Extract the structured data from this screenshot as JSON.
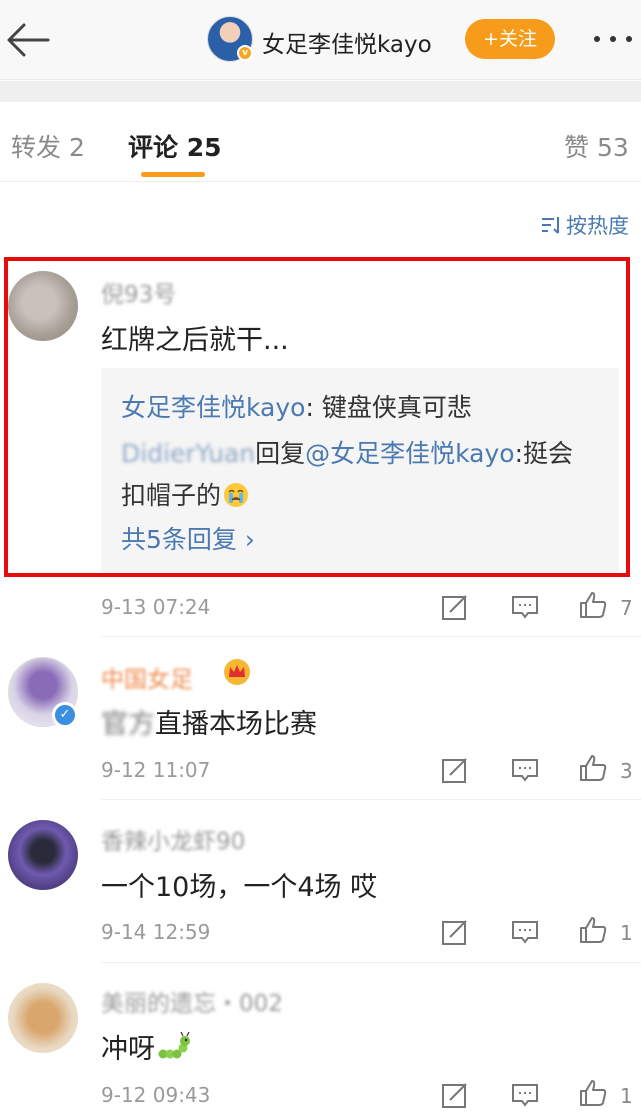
{
  "header": {
    "title": "女足李佳悦kayo",
    "follow_label": "+关注"
  },
  "tabs": [
    {
      "label": "转发 2"
    },
    {
      "label": "评论 25"
    },
    {
      "label": "赞 53"
    }
  ],
  "sort_label": "按热度",
  "comments": [
    {
      "user": "倪93号",
      "text": "红牌之后就干...",
      "time": "9-13 07:24",
      "likes": "7",
      "replies": {
        "first_user": "女足李佳悦kayo",
        "first_text": ": 键盘侠真可悲",
        "second_user": "DidierYuan",
        "second_verb": "回复",
        "second_mention": "@女足李佳悦kayo",
        "second_text_line1": ":挺会",
        "second_text_line2": "扣帽子的",
        "more": "共5条回复 ›"
      }
    },
    {
      "user": "中国女足",
      "text_blurred": "官",
      "text_blurred2": "方",
      "text": "直播本场比赛",
      "time": "9-12 11:07",
      "likes": "3"
    },
    {
      "user": "香辣小龙虾90",
      "text": "一个10场，一个4场 哎",
      "time": "9-14 12:59",
      "likes": "1"
    },
    {
      "user": "美丽的遗忘・002",
      "text": "冲呀",
      "time": "9-12 09:43",
      "likes": "1"
    }
  ],
  "icons": {
    "back": "arrow-left-icon",
    "more": "more-dots-icon",
    "sort": "sort-icon",
    "repost": "repost-icon",
    "comment": "comment-icon",
    "like": "thumbs-up-icon"
  },
  "colors": {
    "accent": "#f79b1a",
    "link": "#4a7ab1",
    "highlight": "#e80b0b"
  }
}
